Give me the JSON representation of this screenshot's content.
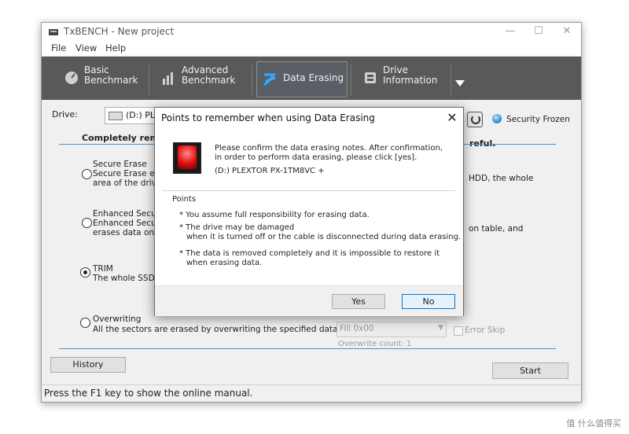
{
  "window": {
    "title": "TxBENCH - New project",
    "controls": {
      "minimize": "—",
      "maximize": "☐",
      "close": "✕"
    }
  },
  "menu": [
    "File",
    "View",
    "Help"
  ],
  "tabs": [
    {
      "label": "Basic\nBenchmark",
      "icon": "speedometer-icon",
      "active": false
    },
    {
      "label": "Advanced\nBenchmark",
      "icon": "bar-chart-icon",
      "active": false
    },
    {
      "label": "Data Erasing",
      "icon": "eraser-stack-icon",
      "active": true
    },
    {
      "label": "Drive\nInformation",
      "icon": "drive-info-icon",
      "active": false
    }
  ],
  "drive": {
    "label": "Drive:",
    "selected": "(D:) PLEX",
    "security_status": "Security Frozen"
  },
  "section": {
    "heading": "Completely remov",
    "heading_right": "reful."
  },
  "options": [
    {
      "title": "Secure Erase",
      "line1": "Secure Erase eras",
      "line2": "area of the drive i",
      "right_text": "HDD, the whole",
      "checked": false
    },
    {
      "title": "Enhanced Secure E",
      "line1": "Enhanced Secure E",
      "line2": "erases data on NA",
      "right_text": "on table, and",
      "checked": false
    },
    {
      "title": "TRIM",
      "line1": "The whole SSD/NV",
      "checked": true
    },
    {
      "title": "Overwriting",
      "line1": "All the sectors are erased by overwriting the specified data.",
      "checked": false
    }
  ],
  "overwrite": {
    "fill_value": "Fill 0x00",
    "error_skip": "Error Skip",
    "count_label": "Overwrite count: 1"
  },
  "buttons": {
    "history": "History",
    "start": "Start"
  },
  "status_bar": "Press the F1 key to show the online manual.",
  "dialog": {
    "title": "Points to remember when using Data Erasing",
    "close": "✕",
    "message_line1": "Please confirm the data erasing notes. After confirmation,",
    "message_line2": "in order to perform data erasing, please click [yes].",
    "drive_name": "(D:) PLEXTOR PX-1TM8VC +",
    "points_heading": "Points",
    "point1": "* You assume full responsibility for erasing data.",
    "point2_line1": "* The drive may be damaged",
    "point2_line2": "when it is turned off or the cable is disconnected during data erasing.",
    "point3_line1": "* The data is removed completely and it is impossible to restore it",
    "point3_line2": "when erasing data.",
    "yes": "Yes",
    "no": "No"
  },
  "watermark": "值 什么值得买"
}
